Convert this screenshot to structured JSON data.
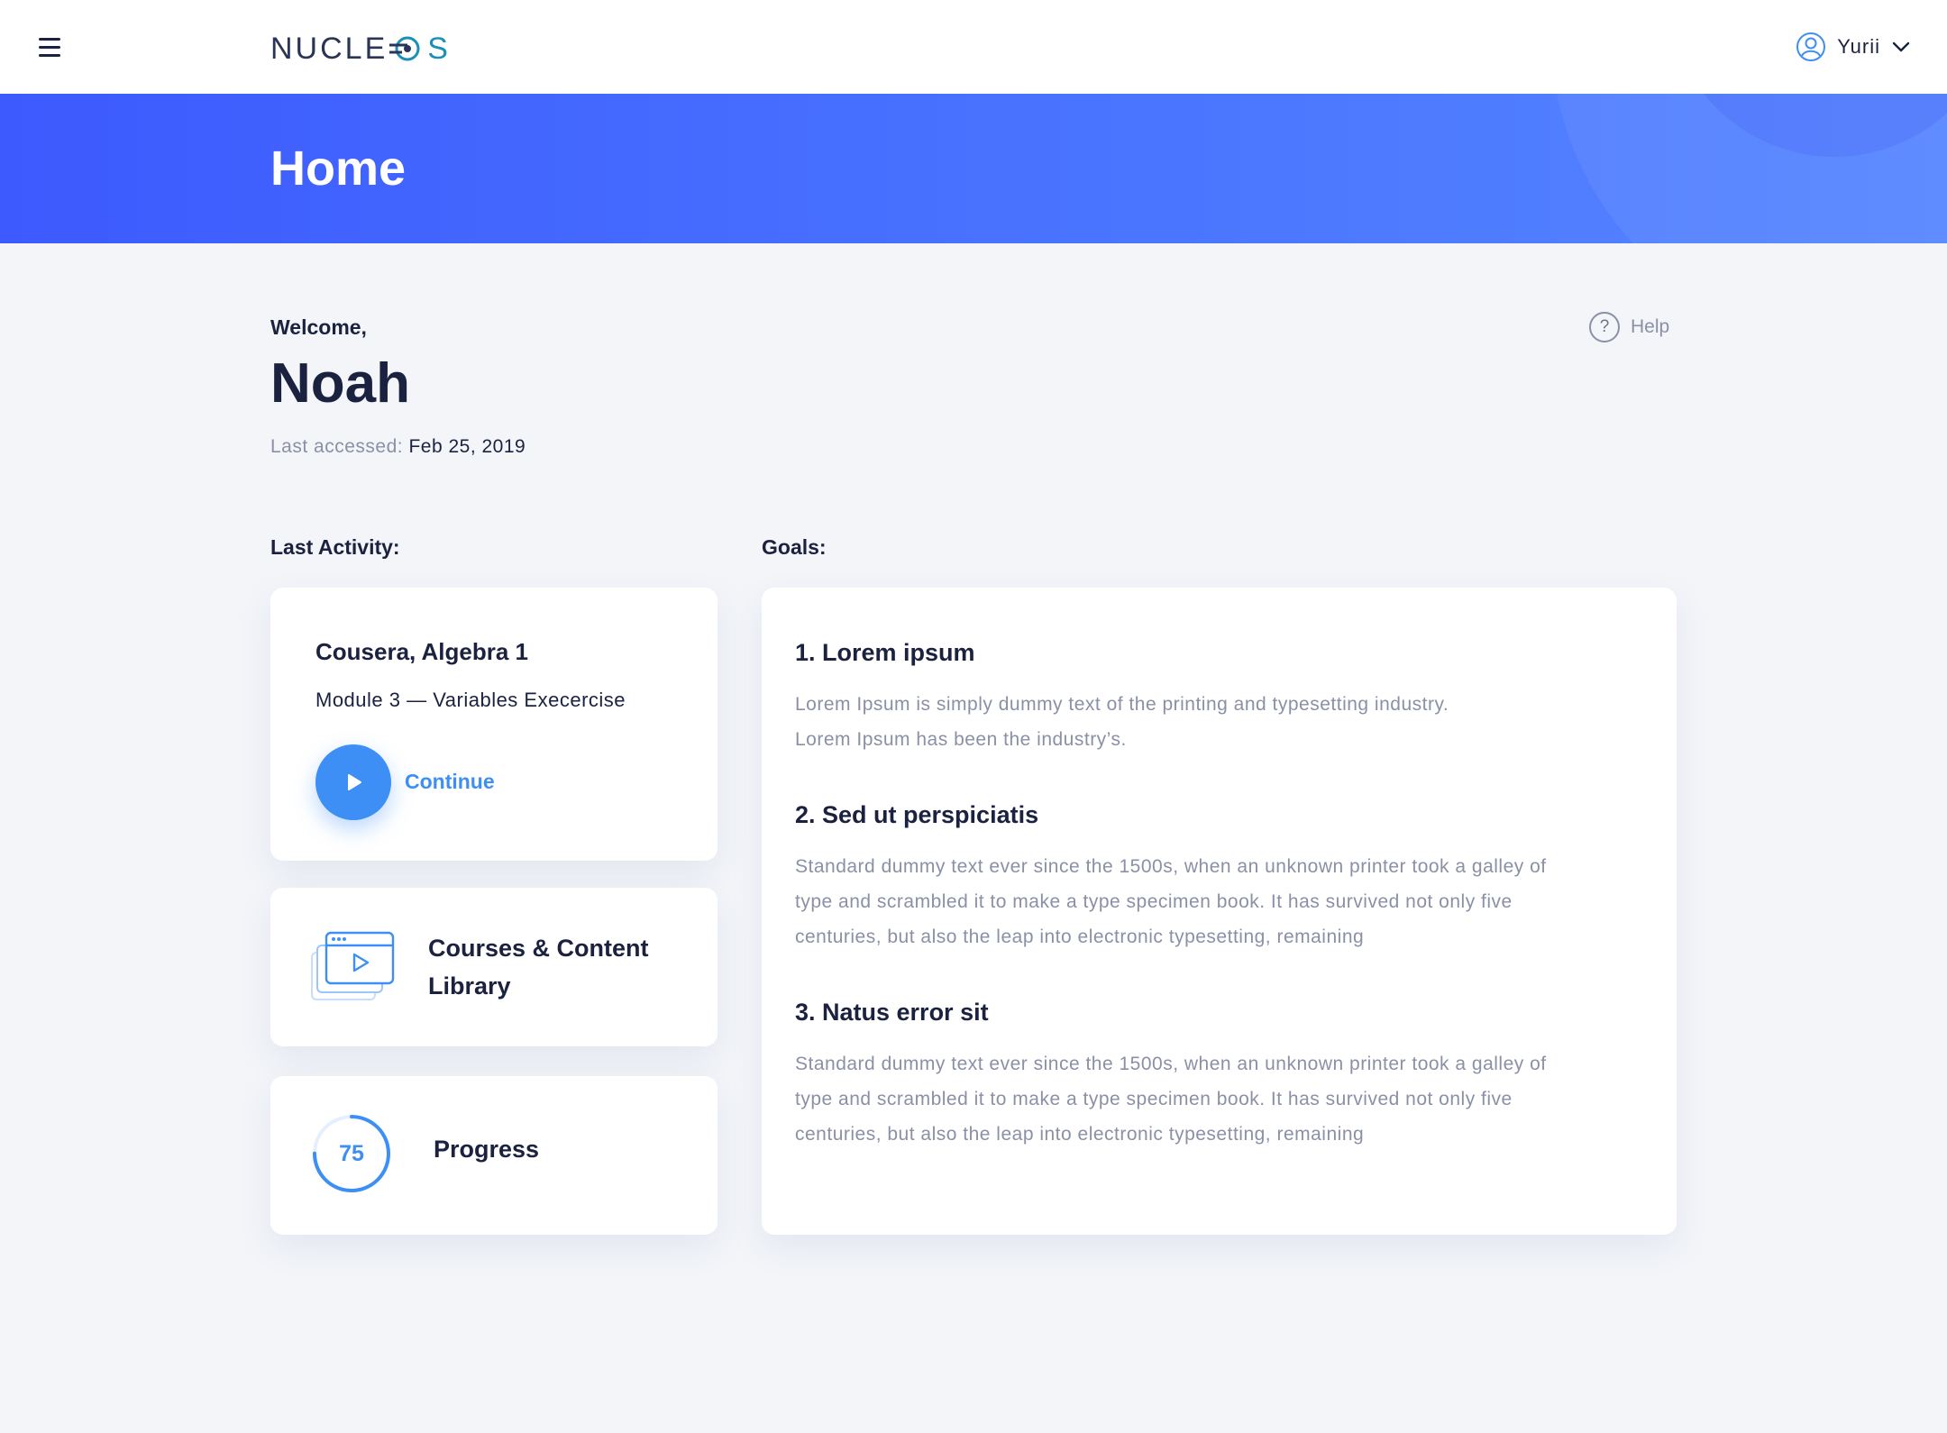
{
  "header": {
    "logo_text": "NUCLE",
    "logo_tail": "S",
    "user_name": "Yurii"
  },
  "hero": {
    "title": "Home"
  },
  "welcome": {
    "label": "Welcome,",
    "name": "Noah",
    "last_accessed_label": "Last accessed:",
    "last_accessed_value": "Feb 25, 2019"
  },
  "help": {
    "label": "Help",
    "icon_glyph": "?"
  },
  "last_activity": {
    "section_label": "Last Activity:",
    "course_title": "Cousera, Algebra 1",
    "module": "Module 3 — Variables Execercise",
    "continue_label": "Continue"
  },
  "library": {
    "label": "Courses & Content Library"
  },
  "progress": {
    "label": "Progress",
    "value": 75,
    "value_text": "75"
  },
  "goals": {
    "section_label": "Goals:",
    "items": [
      {
        "title": "1. Lorem ipsum",
        "text": "Lorem Ipsum is simply dummy text of the printing and typesetting industry. Lorem Ipsum has been the industry’s."
      },
      {
        "title": "2. Sed ut perspiciatis",
        "text": "Standard dummy text ever since the 1500s, when an unknown printer took a galley of type and scrambled it to make a type specimen book. It has survived not only five centuries, but also the leap into electronic typesetting, remaining"
      },
      {
        "title": "3. Natus error sit",
        "text": "Standard dummy text ever since the 1500s, when an unknown printer took a galley of type and scrambled it to make a type specimen book. It has survived not only five centuries, but also the leap into electronic typesetting, remaining"
      }
    ]
  },
  "colors": {
    "accent": "#3d8ff5",
    "hero_start": "#3d5afe",
    "hero_end": "#5585ff",
    "text_dark": "#1b2240",
    "text_muted": "#8a90a6",
    "background": "#f3f5f9"
  },
  "icons": {
    "menu": "hamburger-icon",
    "user": "user-avatar-icon",
    "dropdown": "chevron-down-icon",
    "help": "question-circle-icon",
    "play": "play-icon",
    "library": "video-library-icon",
    "progress": "progress-ring-icon"
  }
}
